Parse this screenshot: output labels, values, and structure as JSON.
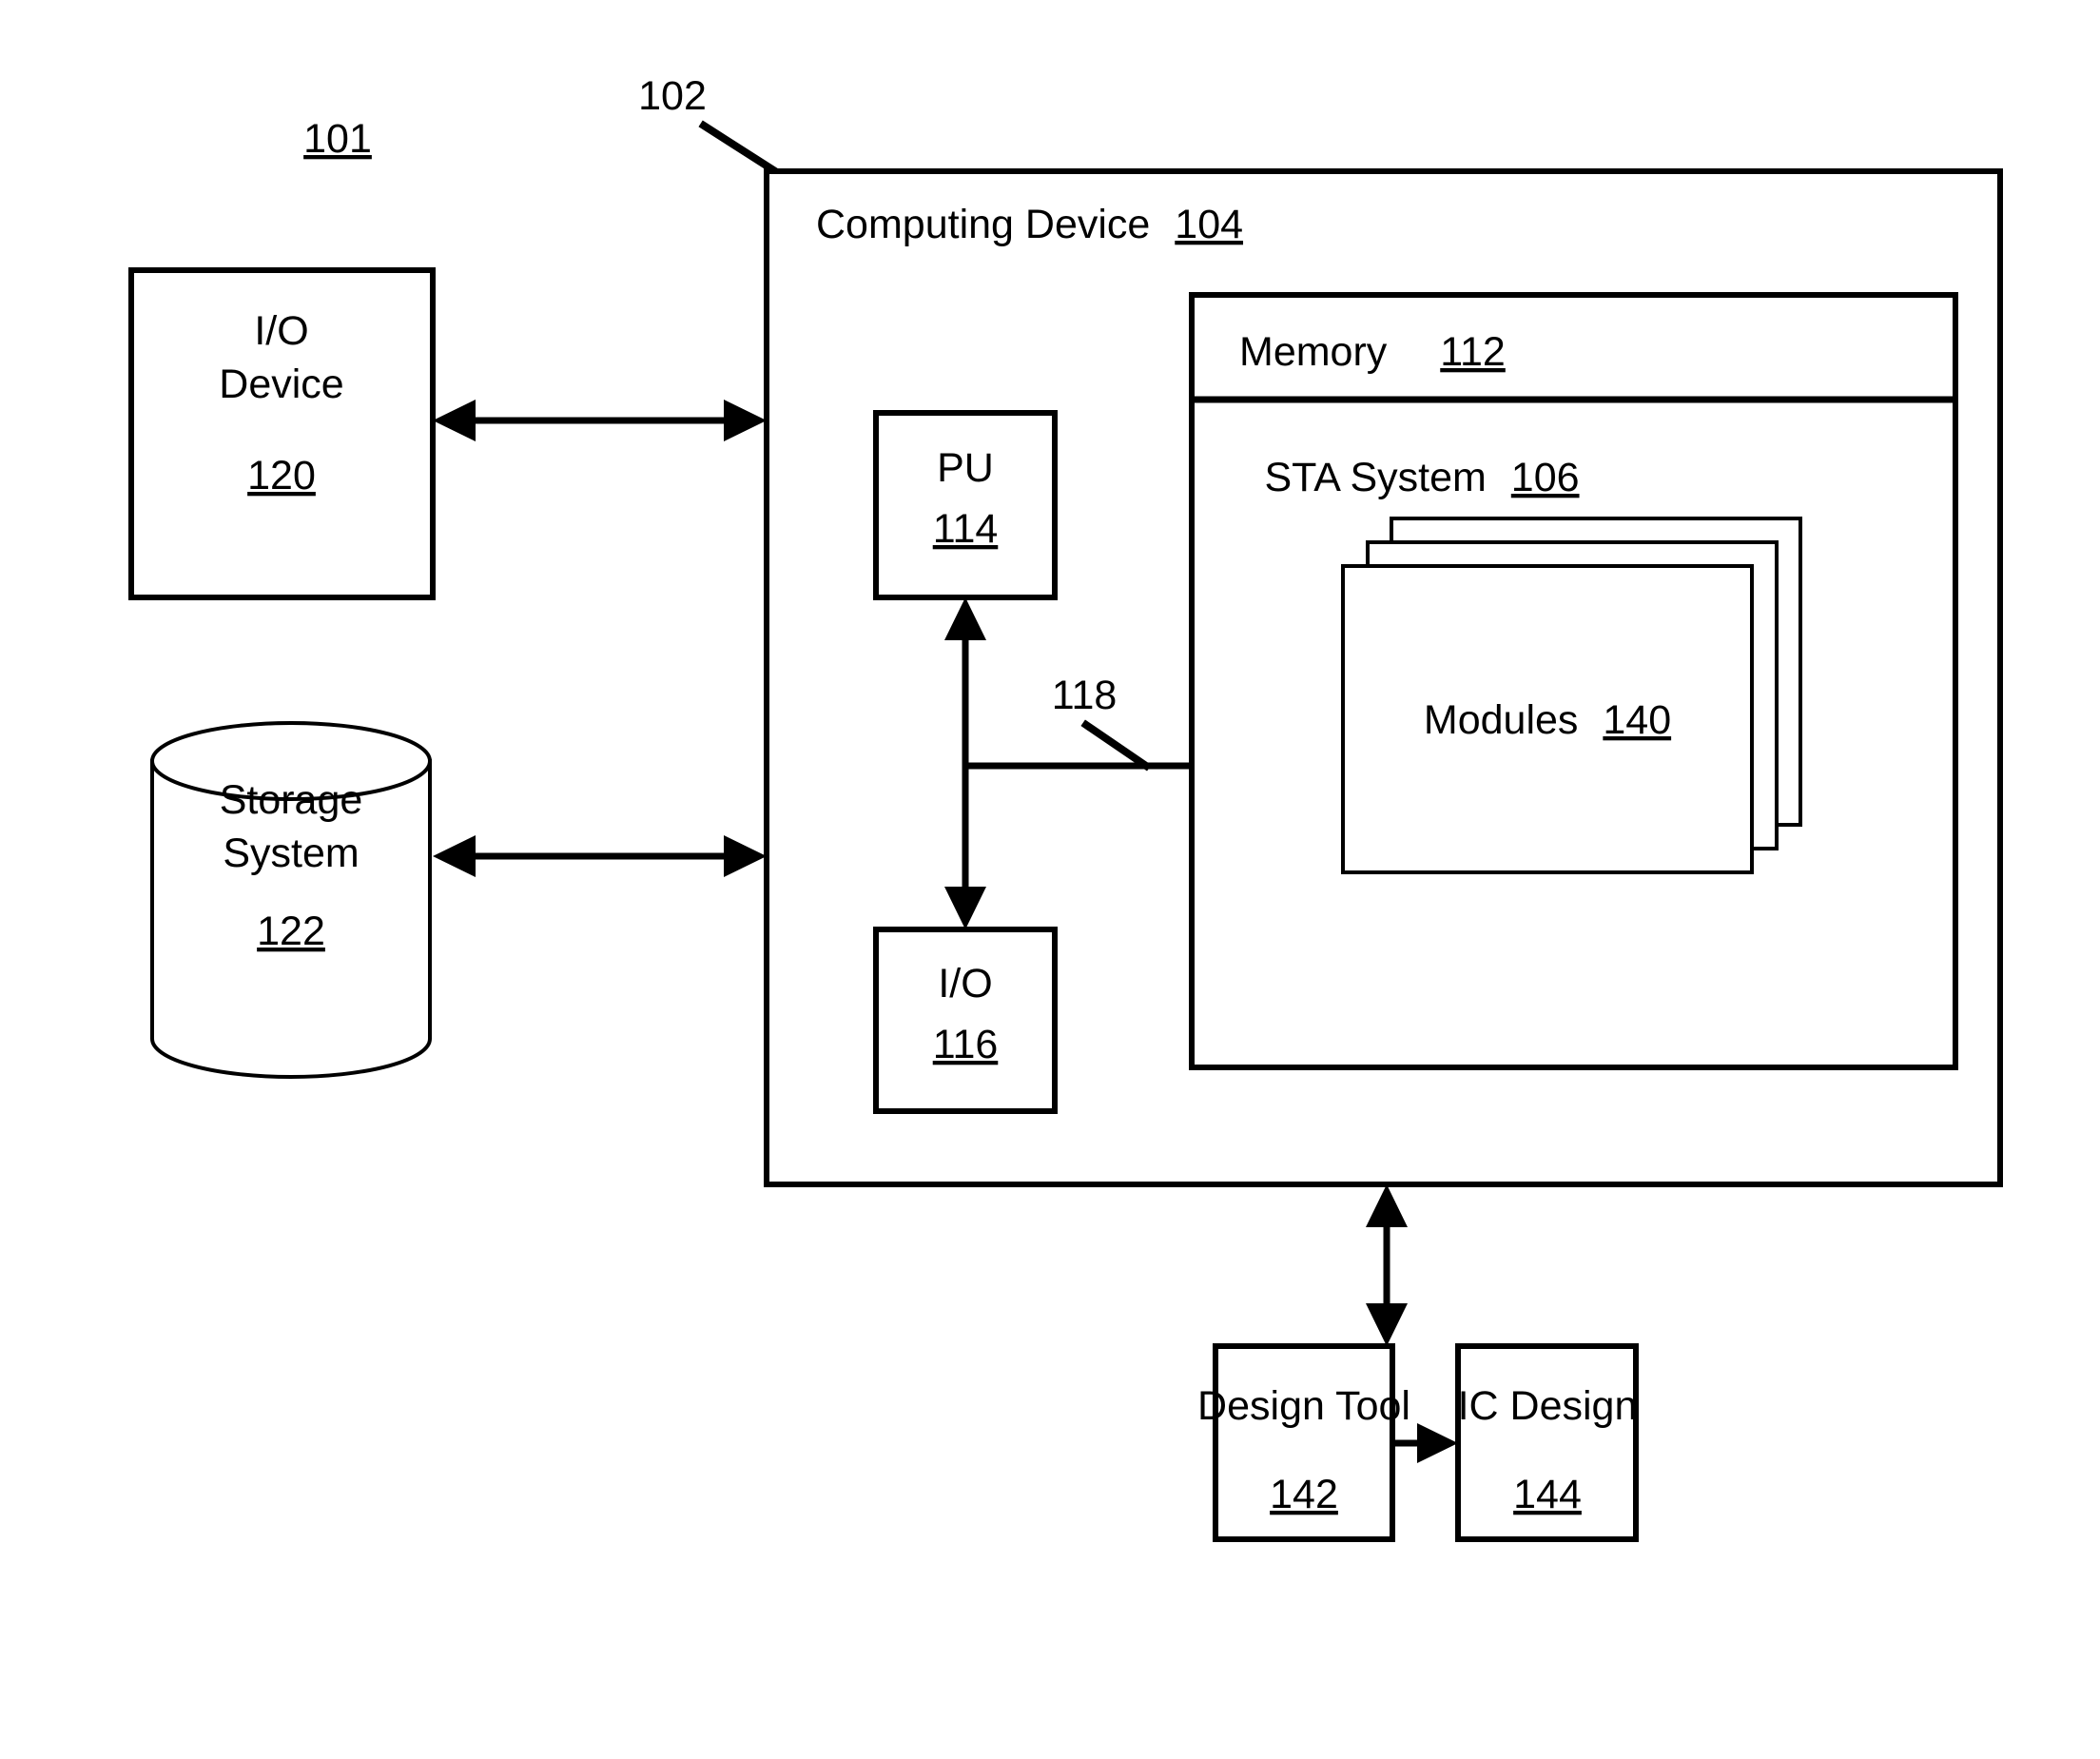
{
  "figure": {
    "system_ref": "101",
    "computing_env_ref": "102",
    "bus_ref": "118"
  },
  "computing_device": {
    "label": "Computing Device",
    "ref": "104"
  },
  "io_device": {
    "line1": "I/O",
    "line2": "Device",
    "ref": "120"
  },
  "storage_system": {
    "line1": "Storage",
    "line2": "System",
    "ref": "122"
  },
  "pu": {
    "label": "PU",
    "ref": "114"
  },
  "io_internal": {
    "label": "I/O",
    "ref": "116"
  },
  "memory": {
    "label": "Memory",
    "ref": "112"
  },
  "sta_system": {
    "label": "STA System",
    "ref": "106"
  },
  "modules": {
    "label": "Modules",
    "ref": "140"
  },
  "design_tool": {
    "label": "Design Tool",
    "ref": "142"
  },
  "ic_design": {
    "label": "IC Design",
    "ref": "144"
  },
  "colors": {
    "stroke": "#000000",
    "background": "#ffffff"
  }
}
